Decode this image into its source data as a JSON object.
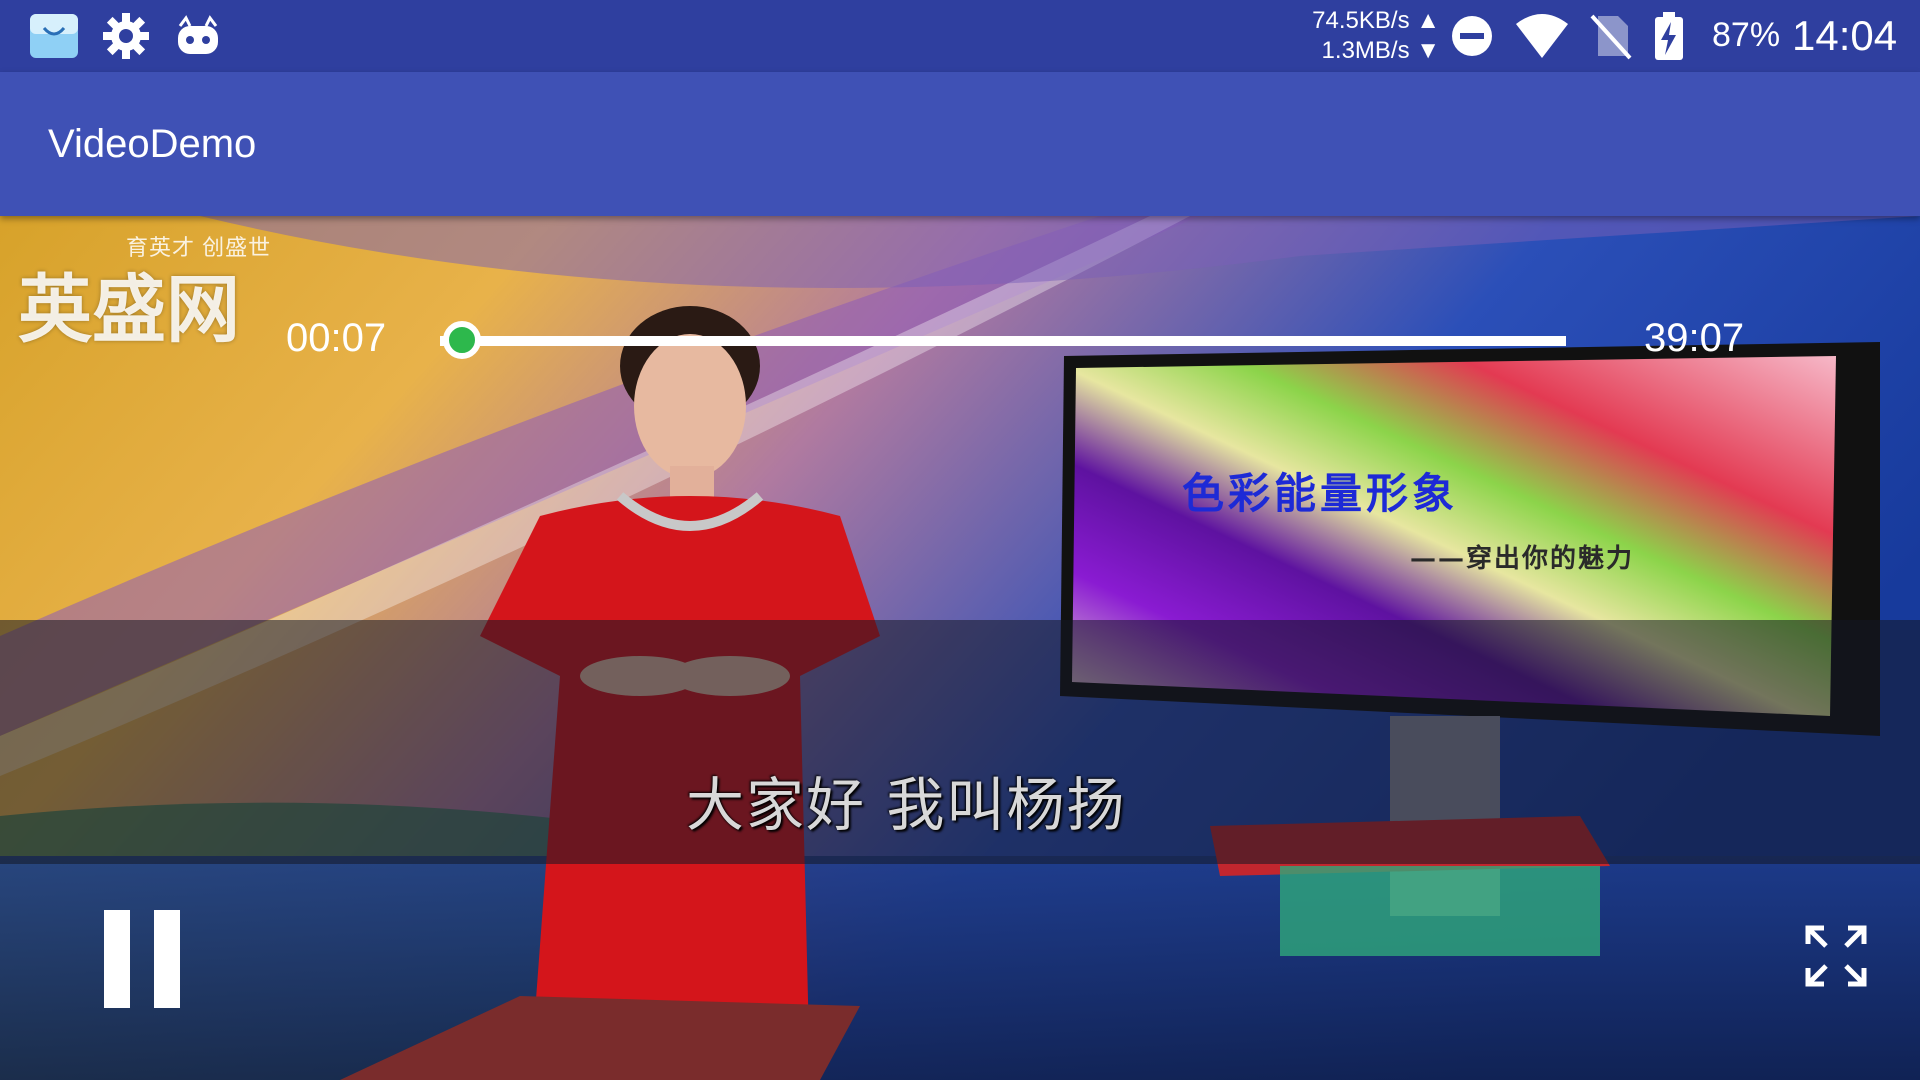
{
  "status_bar": {
    "icons_left": [
      "shopping-bag-icon",
      "settings-gear-icon",
      "cat-robot-icon"
    ],
    "net_speed_up": "74.5KB/s",
    "net_speed_down": "1.3MB/s",
    "icons_right": [
      "do-not-disturb-icon",
      "wifi-icon",
      "no-sim-icon",
      "battery-charging-icon"
    ],
    "battery_percent": "87%",
    "time": "14:04"
  },
  "app_bar": {
    "title": "VideoDemo",
    "color": "#3f51b5"
  },
  "video": {
    "watermark_slogan": "育英才 创盛世",
    "watermark_logo": "英盛网",
    "screen_title": "色彩能量形象",
    "screen_subtitle": "——穿出你的魅力",
    "caption": "大家好 我叫杨扬"
  },
  "controller": {
    "state": "playing",
    "current_time": "00:07",
    "total_time": "39:07",
    "progress": 0.003,
    "accent_color": "#2db84c"
  }
}
